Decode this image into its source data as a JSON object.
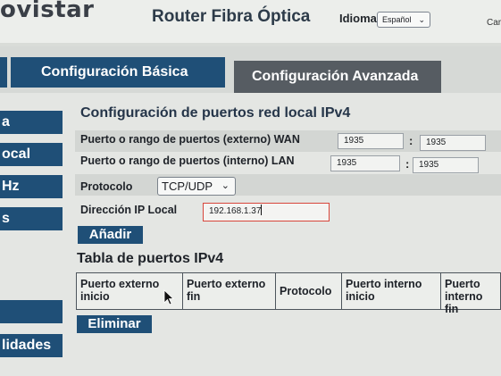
{
  "header": {
    "logo_text": "ovistar",
    "router_title": "Router Fibra Óptica",
    "language_label": "Idioma",
    "language_value": "Español",
    "right_cut_text": "Car"
  },
  "tabs": {
    "basic": "Configuración Básica",
    "advanced": "Configuración Avanzada"
  },
  "sidebar": {
    "items": [
      "a",
      "ocal",
      "Hz",
      "s",
      "",
      "lidades"
    ]
  },
  "form": {
    "section_title": "Configuración de puertos red local IPv4",
    "wan_label": "Puerto o rango de puertos (externo) WAN",
    "wan_start": "1935",
    "wan_end": "1935",
    "lan_label": "Puerto o rango de puertos (interno) LAN",
    "lan_start": "1935",
    "lan_end": "1935",
    "colon": ":",
    "protocol_label": "Protocolo",
    "protocol_value": "TCP/UDP",
    "ip_label": "Dirección IP Local",
    "ip_value": "192.168.1.37",
    "add_button": "Añadir"
  },
  "table": {
    "title": "Tabla de puertos IPv4",
    "columns": [
      "Puerto externo inicio",
      "Puerto externo fin",
      "Protocolo",
      "Puerto interno inicio",
      "Puerto interno fin"
    ],
    "delete_button": "Eliminar"
  },
  "colors": {
    "primary": "#1f4f77",
    "secondary_tab": "#565c62",
    "error_border": "#d8463b"
  }
}
